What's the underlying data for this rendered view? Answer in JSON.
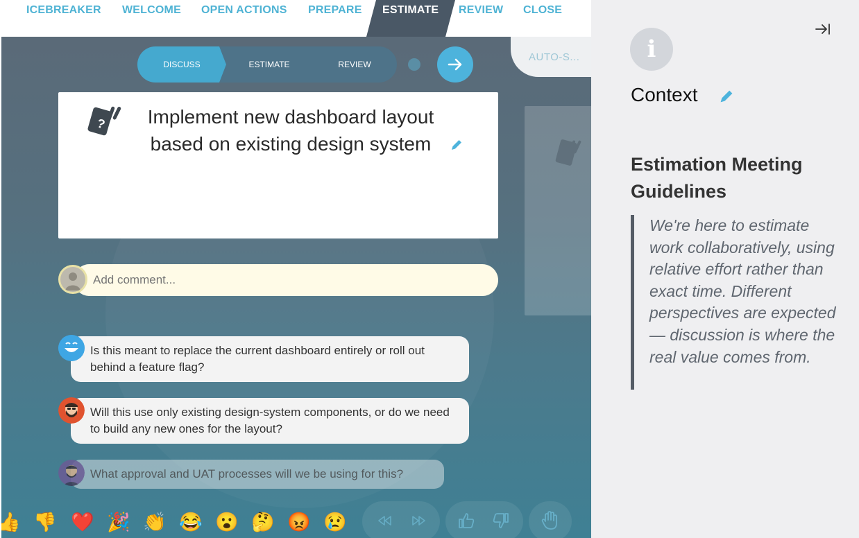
{
  "nav": {
    "stages": [
      {
        "label": "ICEBREAKER",
        "active": false
      },
      {
        "label": "WELCOME",
        "active": false
      },
      {
        "label": "OPEN ACTIONS",
        "active": false
      },
      {
        "label": "PREPARE",
        "active": false
      },
      {
        "label": "ESTIMATE",
        "active": true
      },
      {
        "label": "REVIEW",
        "active": false
      },
      {
        "label": "CLOSE",
        "active": false
      }
    ]
  },
  "substeps": {
    "items": [
      {
        "label": "DISCUSS",
        "active": true
      },
      {
        "label": "ESTIMATE",
        "active": false
      },
      {
        "label": "REVIEW",
        "active": false
      }
    ],
    "next_icon": "arrow-right-icon"
  },
  "auto_select": {
    "label": "AUTO-S..."
  },
  "story": {
    "title": "Implement new dashboard layout based on existing design system",
    "icon": "question-cards-icon"
  },
  "comment_input": {
    "placeholder": "Add comment..."
  },
  "comments": [
    {
      "text": "Is this meant to replace the current dashboard entirely or roll out behind a feature flag?",
      "avatar": "laughing-face-avatar"
    },
    {
      "text": "Will this use only existing design-system components, or do we need to build any new ones for the layout?",
      "avatar": "bearded-man-avatar"
    },
    {
      "text": "What approval and UAT processes will we be using for this?",
      "avatar": "purple-user-avatar"
    }
  ],
  "reactions": [
    {
      "emoji": "👍",
      "name": "thumbs-up"
    },
    {
      "emoji": "👎",
      "name": "thumbs-down"
    },
    {
      "emoji": "❤️",
      "name": "heart"
    },
    {
      "emoji": "🎉",
      "name": "party"
    },
    {
      "emoji": "👏",
      "name": "clap"
    },
    {
      "emoji": "😂",
      "name": "laugh"
    },
    {
      "emoji": "😮",
      "name": "surprised"
    },
    {
      "emoji": "🤔",
      "name": "thinking"
    },
    {
      "emoji": "😡",
      "name": "angry"
    },
    {
      "emoji": "😢",
      "name": "cry"
    }
  ],
  "controls": [
    "rewind-icon",
    "fast-forward-icon",
    "like-icon",
    "dislike-icon",
    "raise-hand-icon"
  ],
  "panel": {
    "title": "Context",
    "guideline_title": "Estimation Meeting Guidelines",
    "guideline_text": "We're here to estimate work collaboratively, using relative effort rather than exact time. Different perspectives are expected — discussion is where the real value comes from."
  },
  "colors": {
    "accent": "#4db3dc",
    "nav_text": "#4fb3d4",
    "active_stage": "#4a5866",
    "panel_bg": "#efeff1"
  }
}
